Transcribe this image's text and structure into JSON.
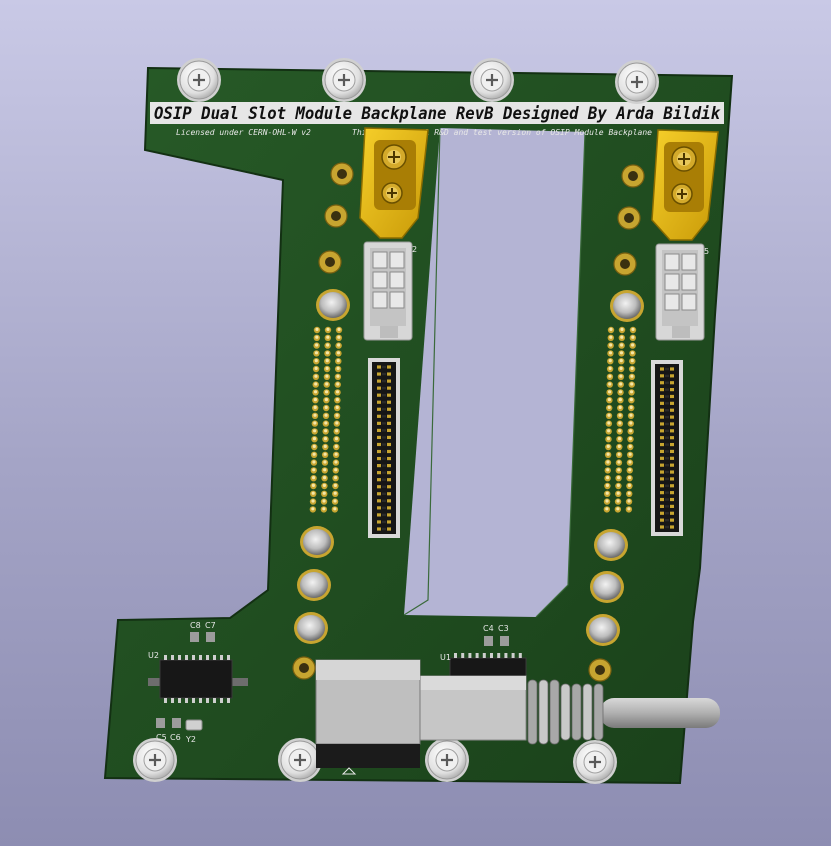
{
  "board": {
    "title": "OSIP Dual Slot Module Backplane RevB Designed By Arda Bildik",
    "license": "Licensed under CERN-OHL-W v2",
    "note": "This is internal R&D and test version of OSIP Module Backplane"
  },
  "refdes": {
    "c8": "C8",
    "c7": "C7",
    "u2": "U2",
    "c5": "C5",
    "c6": "C6",
    "y2": "Y2",
    "c4": "C4",
    "c3": "C3",
    "u1": "U1",
    "j2": "2",
    "j5": "5"
  },
  "colors": {
    "pcb": "#1f4a1f",
    "pcb_edge": "#163616",
    "silkscreen": "#e6e6e6",
    "gold": "#c7a530",
    "xt60": "#e8b910"
  }
}
